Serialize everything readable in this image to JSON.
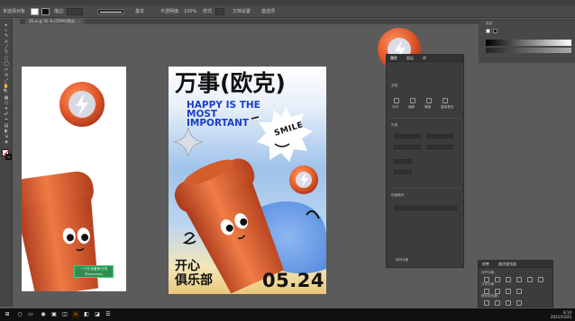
{
  "control_bar": {
    "items": [
      "未选择对象",
      "描边:",
      "基本",
      "不透明度:",
      "100%",
      "样式:",
      "文档设置",
      "首选项"
    ],
    "swatch_fill": "#ffffff",
    "swatch_stroke": "#111111"
  },
  "document_tab": {
    "label": "05.ai @ 50 % (CMYK/预览)",
    "close": "×"
  },
  "toolbar": {
    "tools": [
      "▸",
      "▹",
      "✎",
      "✐",
      "╱",
      "T",
      "▢",
      "◯",
      "✂",
      "⟲",
      "⤢",
      "✋",
      "🔍",
      "▦",
      "⬡",
      "✦",
      "☍",
      "⌖",
      "▤",
      "◐",
      "⇲",
      "◈"
    ]
  },
  "left_artboard": {
    "caption_line1": "一个月·亲爱滴·日常",
    "caption_line2": "@xxxxxxxx"
  },
  "poster": {
    "title": "万事(欧克)",
    "subtitle": "HAPPY IS THE\nMOST\nIMPORTANT",
    "badge_text": "SMILE",
    "bottom_left": "开心\n俱乐部",
    "date": "05.24",
    "accent_color": "#e8632b",
    "text_blue": "#1b3fc8"
  },
  "properties_panel": {
    "tabs": [
      "属性",
      "图层",
      "库"
    ],
    "section_labels": [
      "变换",
      "外观",
      "快速操作"
    ],
    "icon_labels": [
      "对齐",
      "偏移",
      "隔离",
      "重新着色"
    ],
    "footer_label": "排列对象"
  },
  "top_right_panel": {
    "label": "渐变"
  },
  "layers_panel": {
    "tabs": [
      "对齐",
      "路径查找器"
    ],
    "rows": [
      "对齐对象:",
      "分布对象:",
      "路径查找器:"
    ]
  },
  "taskbar": {
    "time": "8:14",
    "date": "2021/10/25",
    "icons": [
      "⊞",
      "○",
      "▭",
      "◉",
      "▣",
      "◫",
      "Ai",
      "◧",
      "◪",
      "☰"
    ]
  }
}
